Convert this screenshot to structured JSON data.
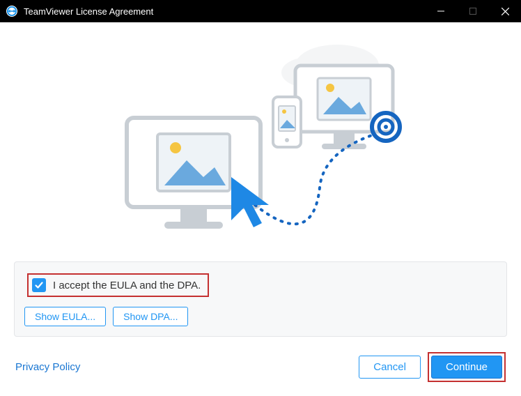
{
  "window": {
    "title": "TeamViewer License Agreement"
  },
  "agreement": {
    "checkbox_label": "I accept the EULA and the DPA.",
    "checked": true,
    "show_eula_label": "Show EULA...",
    "show_dpa_label": "Show DPA..."
  },
  "footer": {
    "privacy_label": "Privacy Policy",
    "cancel_label": "Cancel",
    "continue_label": "Continue"
  }
}
